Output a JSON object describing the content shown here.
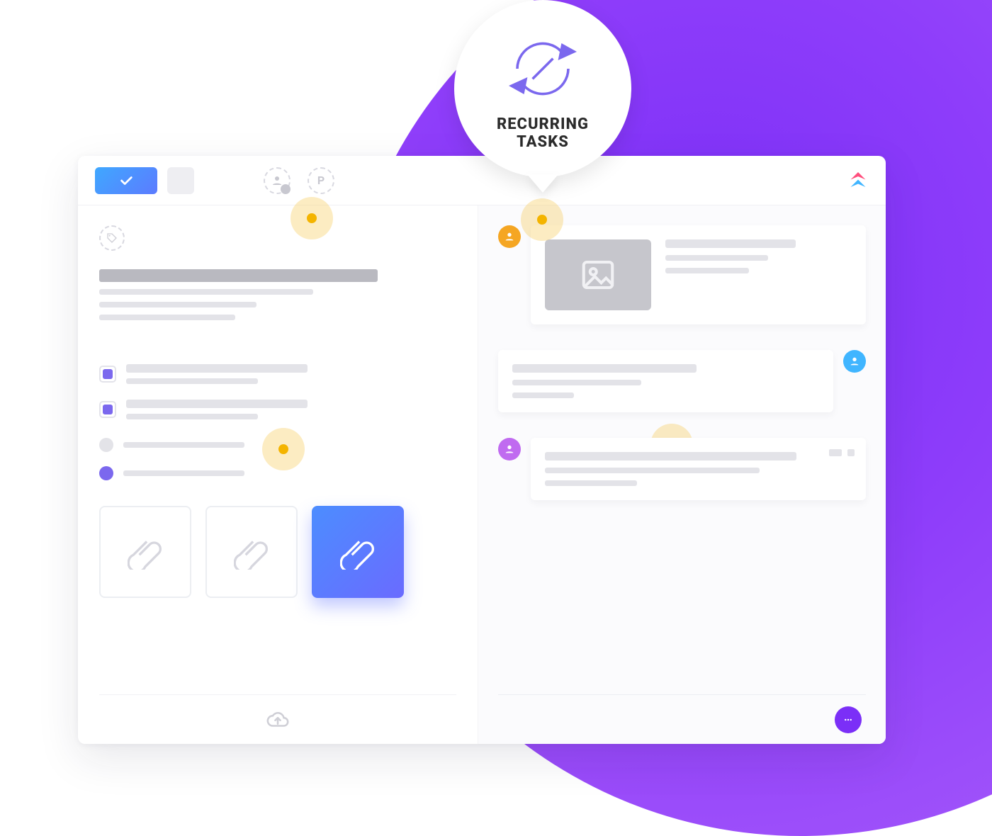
{
  "hero": {
    "title_line1": "RECURRING",
    "title_line2": "TASKS",
    "icon": "refresh-cycle-icon"
  },
  "app": {
    "brand_icon": "clickup-logo",
    "header": {
      "status_button": "check-icon",
      "secondary_status": "",
      "assign_add": "person-add-icon",
      "priority": "flag-p-icon"
    },
    "left": {
      "tag_chip": "tag-icon",
      "title_bar": "",
      "desc_lines": [
        "",
        "",
        ""
      ],
      "subtasks": [
        {
          "checked": true
        },
        {
          "checked": true
        }
      ],
      "items": [
        {
          "color": "grey"
        },
        {
          "color": "purple"
        }
      ],
      "attachments": [
        {
          "state": "default",
          "icon": "paperclip-icon"
        },
        {
          "state": "default",
          "icon": "paperclip-icon"
        },
        {
          "state": "active",
          "icon": "paperclip-icon"
        }
      ],
      "footer_icon": "cloud-upload-icon"
    },
    "right": {
      "comments": [
        {
          "avatar_color": "orange",
          "has_thumbnail": true
        },
        {
          "avatar_color": "blue",
          "has_thumbnail": false
        },
        {
          "avatar_color": "purple",
          "has_thumbnail": false
        }
      ],
      "footer_icon": "chat-bubble-icon"
    }
  },
  "highlights": [
    "title-highlight",
    "item-highlight",
    "comment-top-highlight",
    "comment-bottom-highlight"
  ],
  "colors": {
    "accent_purple": "#7b2ff7",
    "accent_blue_grad_a": "#3fa8ff",
    "accent_blue_grad_b": "#5c7bff",
    "subtask_purple": "#7b68ee",
    "highlight_yellow": "#f4b400"
  }
}
